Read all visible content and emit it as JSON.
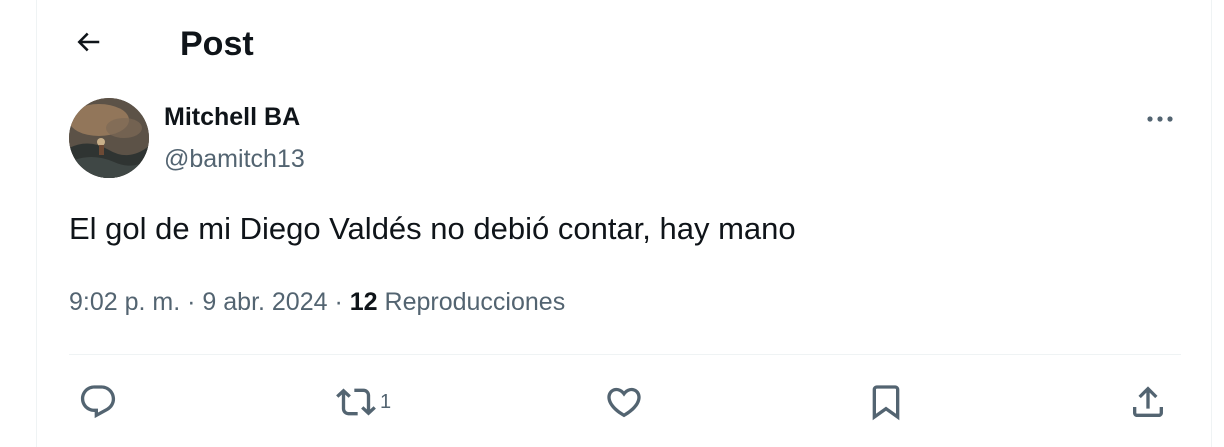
{
  "header": {
    "title": "Post",
    "back_icon": "arrow-left-icon"
  },
  "post": {
    "author": {
      "display_name": "Mitchell BA",
      "handle": "@bamitch13"
    },
    "text": "El gol de mi Diego Valdés no debió contar, hay mano",
    "time": "9:02 p. m.",
    "separator": "·",
    "date": "9 abr. 2024",
    "views_count": "12",
    "views_label": "Reproducciones"
  },
  "actions": {
    "reply_icon": "reply-icon",
    "repost_icon": "repost-icon",
    "repost_count": "1",
    "like_icon": "heart-icon",
    "bookmark_icon": "bookmark-icon",
    "share_icon": "share-icon",
    "more_icon": "more-horizontal-icon"
  },
  "colors": {
    "text_primary": "#0f1419",
    "text_secondary": "#536471",
    "border": "#eff3f4"
  }
}
